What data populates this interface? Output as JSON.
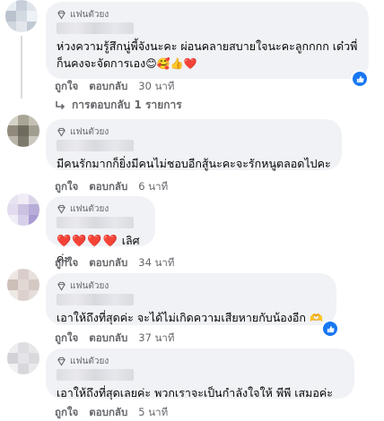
{
  "badge_label": "แฟนตัวยง",
  "actions": {
    "like": "ถูกใจ",
    "reply": "ตอบกลับ"
  },
  "comments": [
    {
      "text": "ห่วงความรู้สึกนู่พี้จังนะคะ ผ่อนคลายสบายใจนะคะลูกกกก เด๋วพี่ก็นคงจะจัดการเอง",
      "emojis": "😊🥰👍❤️",
      "time": "30 นาที",
      "has_reaction": true
    },
    {
      "text": "มีคนรักมากก็ยิ่งมีคนไม่ชอบอีกสู้นะคะจะรักหนูตลอดไปคะ",
      "time": "6 นาที"
    },
    {
      "hearts": "❤️❤️❤️❤️",
      "text": "เลิศค่ะ",
      "time": "34 นาที"
    },
    {
      "text": "เอาให้ถึงที่สุดค่ะ จะได้ไม่เกิดความเสียหายกับน้องอีก",
      "emojis": "🫶",
      "time": "37 นาที",
      "has_reaction": true
    },
    {
      "text": "เอาให้ถึงที่สุดเลยค่ะ พวกเราจะเป็นกำลังใจให้ พีพี เสมอค่ะ",
      "time": "5 นาที"
    }
  ],
  "replies_label": "การตอบกลับ 1 รายการ",
  "colors": {
    "bubble": "#f0f2f5",
    "muted": "#65676b",
    "reaction": "#1877f2"
  }
}
